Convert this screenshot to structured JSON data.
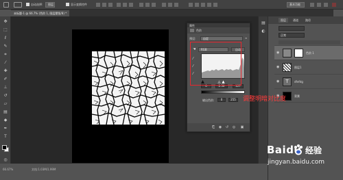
{
  "app": {
    "options_bar": {
      "auto_select_label": "自动选择:",
      "show_transform_label": "显示变换控件"
    },
    "document_tab": "未标题-1 @ 66.7% (色阶 1, 图层蒙版/8) *",
    "status": {
      "zoom": "66.67%",
      "doc_info": "文档:1.03M/1.99M"
    }
  },
  "properties_panel": {
    "title_tab": "属性",
    "sub_tab": "色阶",
    "preset_label": "预设:",
    "preset_value": "自定",
    "channel_value": "RGB",
    "auto_label": "自动",
    "input_black": "0",
    "input_gamma": "2.50",
    "input_white": "127",
    "output_label": "输出色阶:",
    "output_black": "0",
    "output_white": "255",
    "histogram_fill": "#9a9a9a"
  },
  "layers_panel": {
    "tabs": [
      "图层",
      "通道",
      "路径"
    ],
    "blend_mode": "正常",
    "layers": [
      {
        "name": "色阶 1",
        "active": true
      },
      {
        "name": "图层1",
        "active": false
      },
      {
        "name": "dfefdg",
        "active": false
      },
      {
        "name": "背景",
        "active": false
      }
    ]
  },
  "annotation": {
    "text": "调整明暗对比度",
    "color": "#e8262e"
  },
  "watermark": {
    "brand": "Baidu",
    "product": "经验",
    "url": "jingyan.baidu.com"
  }
}
